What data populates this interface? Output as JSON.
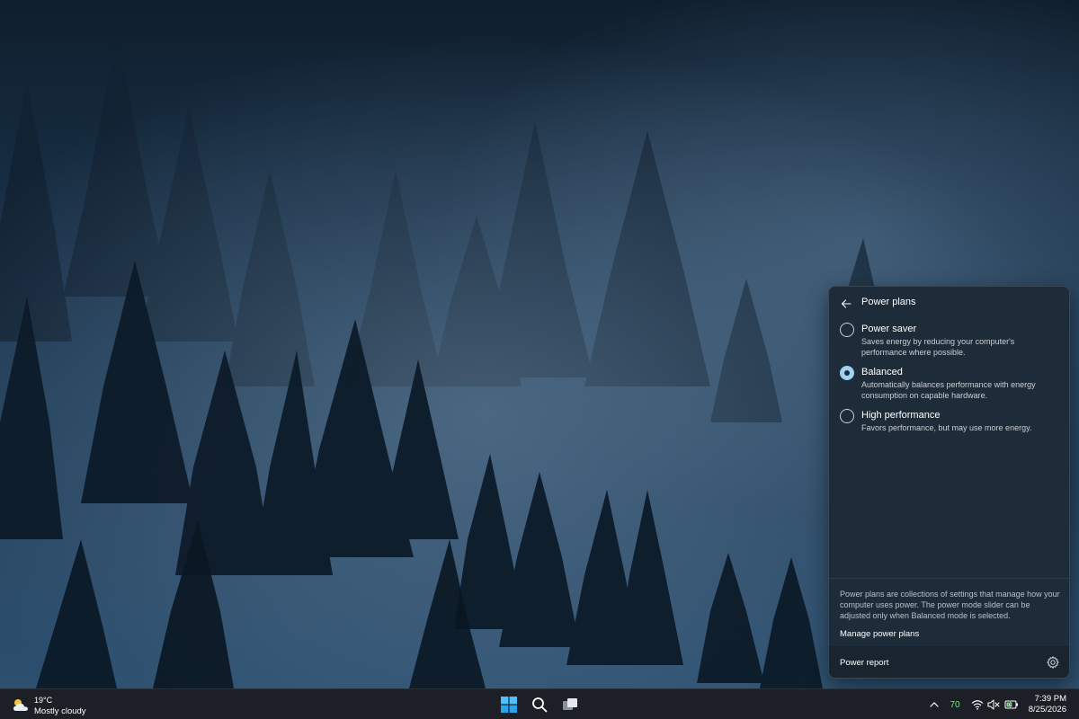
{
  "power_flyout": {
    "title": "Power plans",
    "plans": [
      {
        "name": "Power saver",
        "description": "Saves energy by reducing your computer's performance where possible.",
        "selected": false
      },
      {
        "name": "Balanced",
        "description": "Automatically balances performance with energy consumption on capable hardware.",
        "selected": true
      },
      {
        "name": "High performance",
        "description": "Favors performance, but may use more energy.",
        "selected": false
      }
    ],
    "info_text": "Power plans are collections of settings that manage how your computer uses power. The power mode slider can be adjusted only when Balanced mode is selected.",
    "manage_link": "Manage power plans",
    "report_label": "Power report",
    "accent_color": "#9dd2f3"
  },
  "taskbar": {
    "weather": {
      "temperature": "19°C",
      "condition": "Mostly cloudy",
      "icon": "partly-cloudy-icon"
    },
    "pinned": [
      {
        "name": "start",
        "icon": "windows-logo-icon"
      },
      {
        "name": "search",
        "icon": "search-icon"
      },
      {
        "name": "task-view",
        "icon": "task-view-icon"
      }
    ],
    "tray": {
      "overflow_icon": "chevron-up-icon",
      "value": "70",
      "value_color": "#7ee08a",
      "wifi_icon": "wifi-icon",
      "volume_icon": "volume-muted-icon",
      "battery_icon": "battery-charging-icon"
    },
    "clock": {
      "time": "7:39 PM",
      "date": "8/25/2026"
    }
  }
}
